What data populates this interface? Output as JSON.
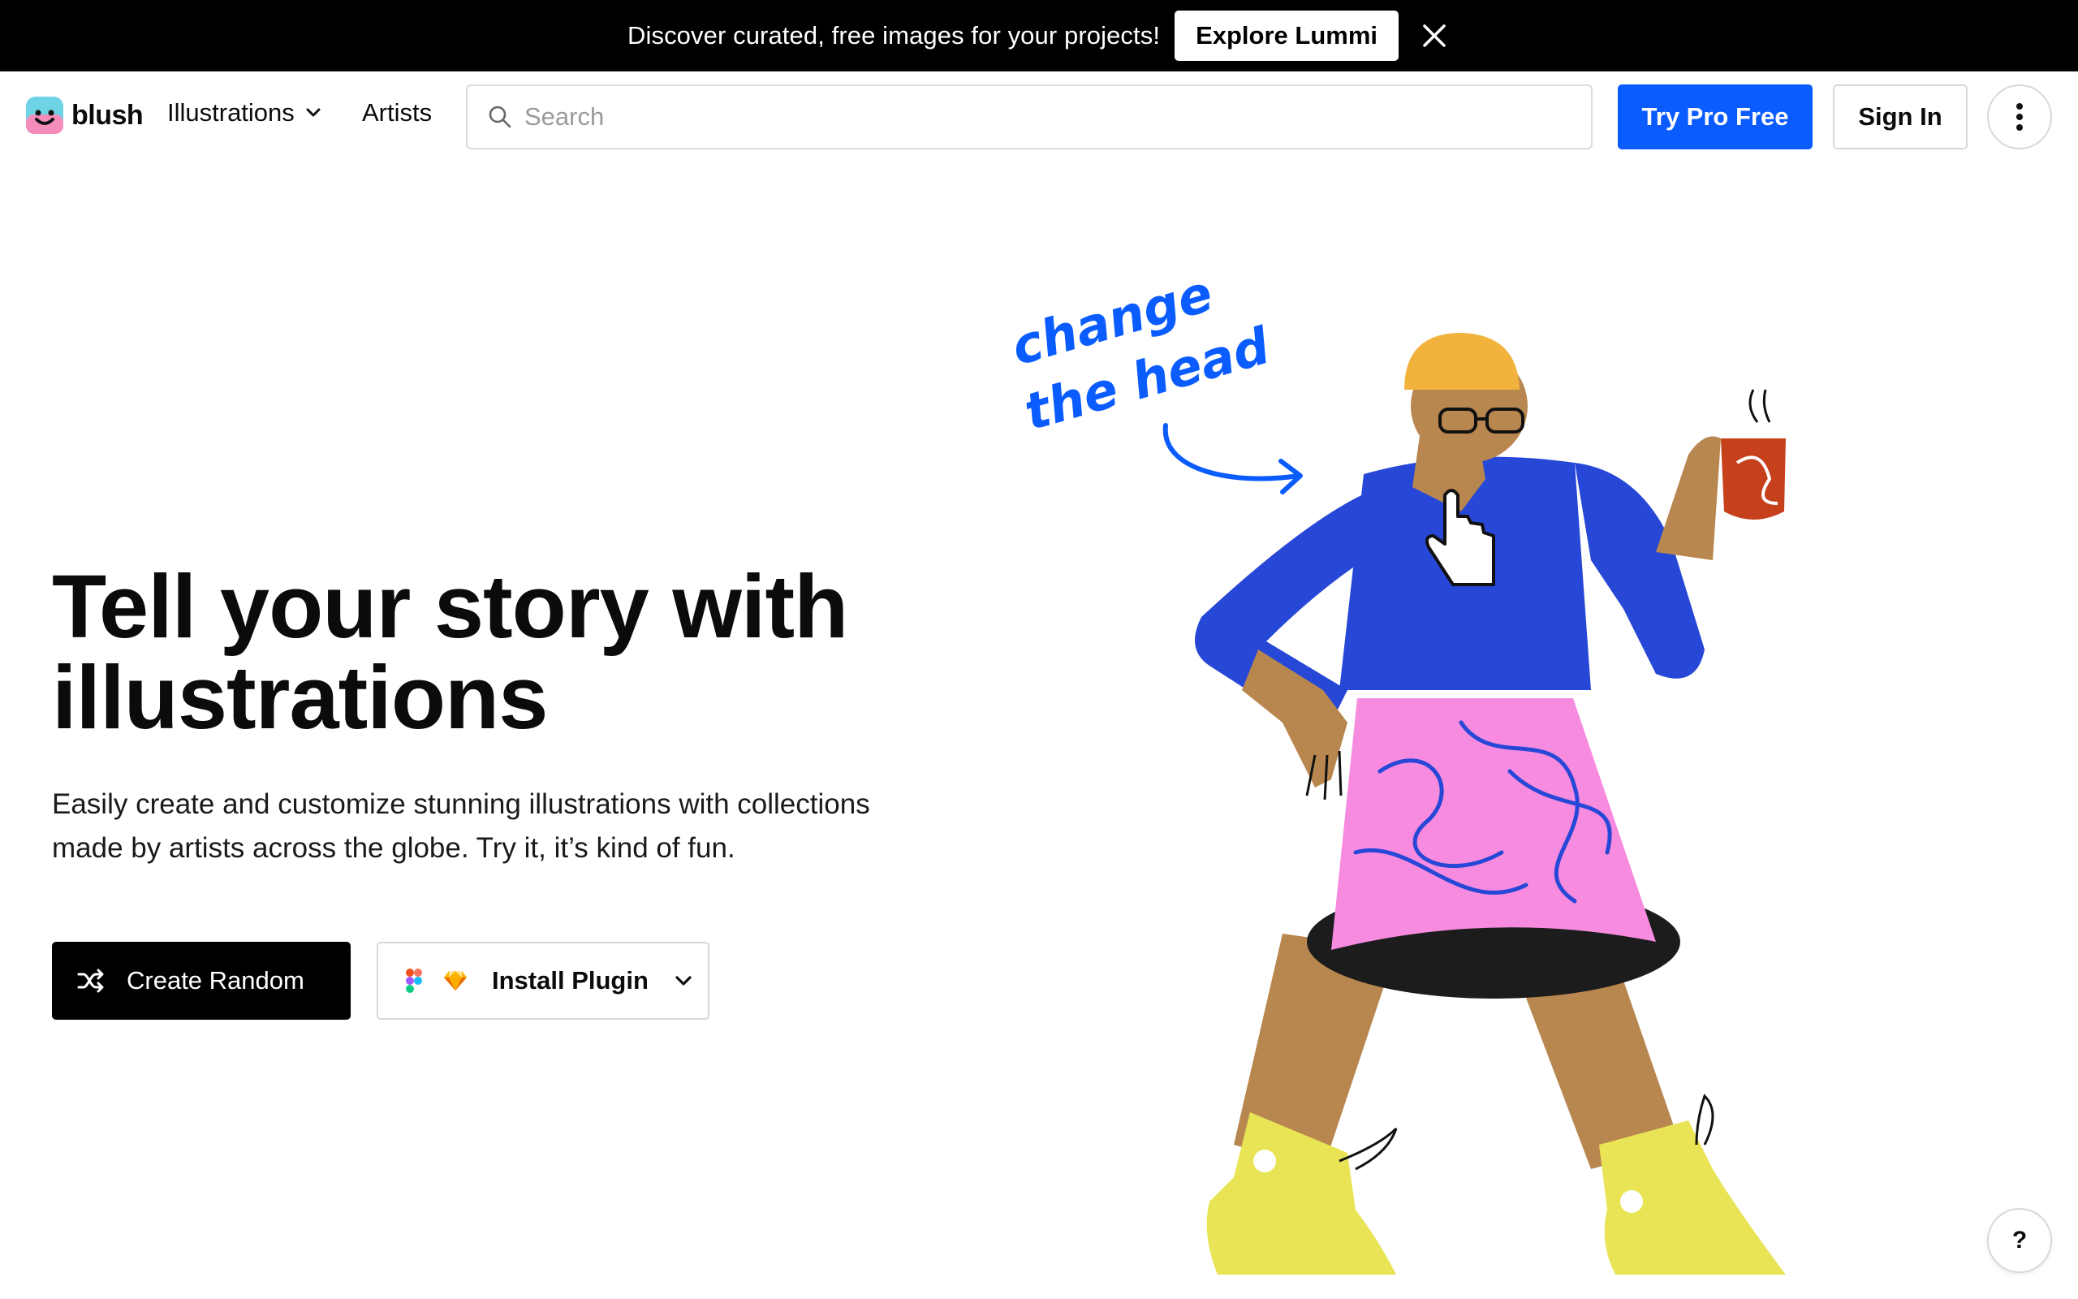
{
  "announcement": {
    "text": "Discover curated, free images for your projects!",
    "button_label": "Explore Lummi"
  },
  "header": {
    "logo_text": "blush",
    "nav": {
      "illustrations_label": "Illustrations",
      "artists_label": "Artists"
    },
    "search_placeholder": "Search",
    "try_pro_label": "Try Pro Free",
    "sign_in_label": "Sign In"
  },
  "hero": {
    "title": "Tell your story with illustrations",
    "subtitle": "Easily create and customize stunning illustrations with collections made by artists across the globe. Try it, it’s kind of fun.",
    "create_random_label": "Create Random",
    "install_plugin_label": "Install Plugin"
  },
  "illustration": {
    "annotation_line1": "change",
    "annotation_line2": "the head"
  },
  "help_label": "?",
  "colors": {
    "brand_blue": "#0b5cff",
    "black": "#000000",
    "shirt_blue": "#2747d6",
    "skirt_pink": "#f78be0",
    "shoes_yellow": "#e8e456",
    "hat_orange": "#f1b33c",
    "skin": "#b8864f",
    "mug_red": "#c6401c"
  }
}
